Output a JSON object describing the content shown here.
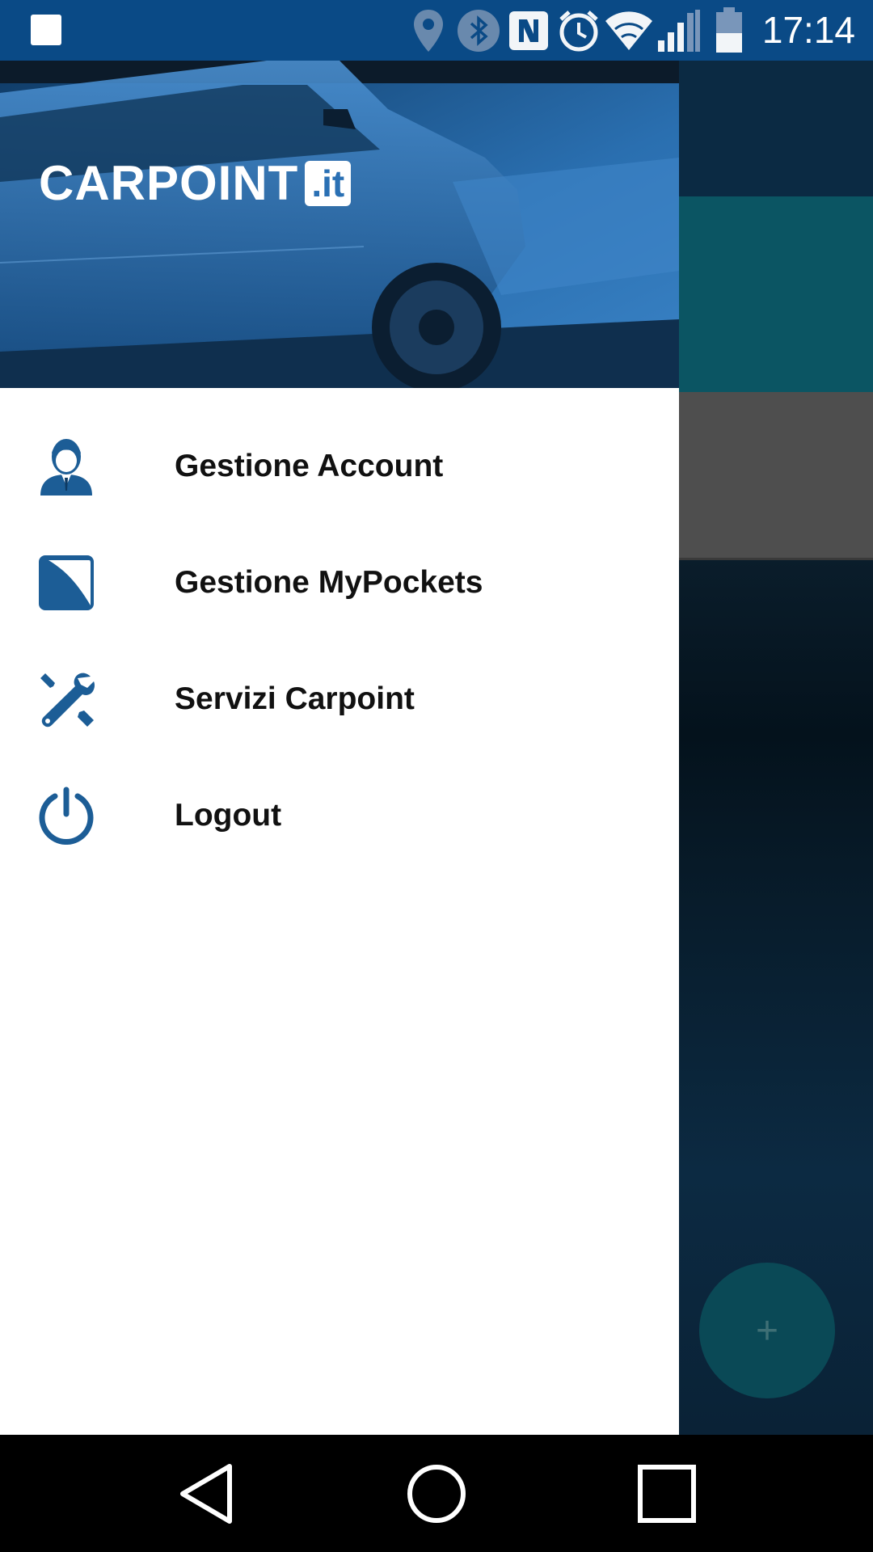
{
  "status_bar": {
    "time": "17:14",
    "icons": [
      "notification-square-icon",
      "location-icon",
      "bluetooth-icon",
      "nfc-icon",
      "alarm-icon",
      "wifi-icon",
      "signal-icon",
      "battery-icon"
    ]
  },
  "drawer": {
    "logo": {
      "text": "CARPOINT",
      "badge": ".it"
    },
    "menu_items": [
      {
        "label": "Gestione Account",
        "icon": "user-account-icon"
      },
      {
        "label": "Gestione MyPockets",
        "icon": "mypockets-icon"
      },
      {
        "label": "Servizi Carpoint",
        "icon": "tools-icon"
      },
      {
        "label": "Logout",
        "icon": "power-icon"
      }
    ]
  },
  "background_app": {
    "fab_label": "+"
  },
  "colors": {
    "status_bar": "#0a4a86",
    "brand_blue": "#1c5d96",
    "teal": "#0b5563"
  },
  "nav_bar": {
    "buttons": [
      "back-icon",
      "home-icon",
      "recents-icon"
    ]
  }
}
